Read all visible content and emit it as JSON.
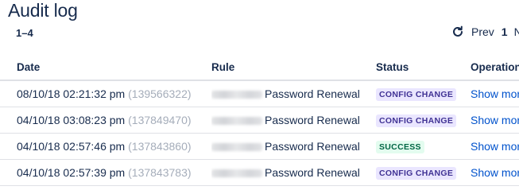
{
  "header": {
    "title": "Audit log",
    "range": "1–4",
    "pager": {
      "prev": "Prev",
      "current_page": "1",
      "next": "N"
    }
  },
  "table": {
    "columns": {
      "date": "Date",
      "rule": "Rule",
      "status": "Status",
      "operations": "Operation"
    },
    "rows": [
      {
        "date": "08/10/18 02:21:32 pm",
        "id": "(139566322)",
        "rule": "Password Renewal",
        "status": "CONFIG CHANGE",
        "status_kind": "config",
        "operation": "Show mor"
      },
      {
        "date": "04/10/18 03:08:23 pm",
        "id": "(137849470)",
        "rule": "Password Renewal",
        "status": "CONFIG CHANGE",
        "status_kind": "config",
        "operation": "Show mor"
      },
      {
        "date": "04/10/18 02:57:46 pm",
        "id": "(137843860)",
        "rule": "Password Renewal",
        "status": "SUCCESS",
        "status_kind": "success",
        "operation": "Show mor"
      },
      {
        "date": "04/10/18 02:57:39 pm",
        "id": "(137843783)",
        "rule": "Password Renewal",
        "status": "CONFIG CHANGE",
        "status_kind": "config",
        "operation": "Show mor"
      }
    ]
  },
  "colors": {
    "config_bg": "#EAE6FF",
    "config_fg": "#403294",
    "success_bg": "#E3FCEF",
    "success_fg": "#006644",
    "link": "#0052CC"
  },
  "icons": {
    "refresh": "refresh-icon"
  }
}
